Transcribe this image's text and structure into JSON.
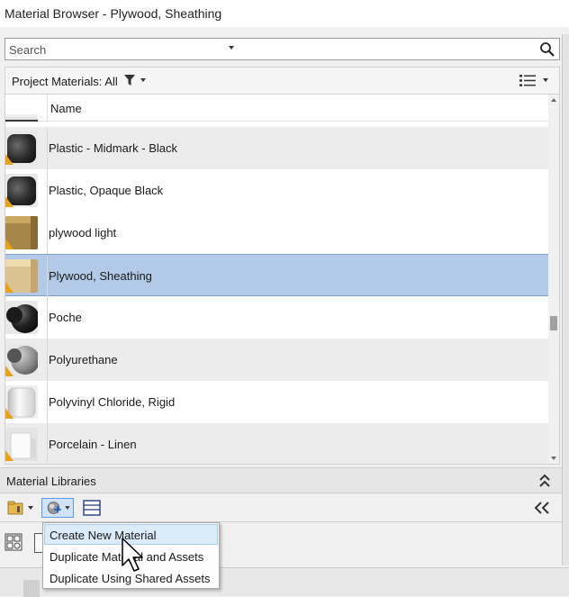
{
  "window": {
    "title": "Material Browser - Plywood, Sheathing"
  },
  "search": {
    "placeholder": "Search"
  },
  "filter": {
    "label": "Project Materials: All"
  },
  "list": {
    "column_header": "Name",
    "rows": [
      {
        "label": "Plastic - Midmark - Black",
        "thumb": "black-cylinder",
        "warning": true,
        "selected": false
      },
      {
        "label": "Plastic, Opaque Black",
        "thumb": "black-cylinder",
        "warning": true,
        "selected": false
      },
      {
        "label": "plywood light",
        "thumb": "wood-cube",
        "warning": true,
        "selected": false
      },
      {
        "label": "Plywood, Sheathing",
        "thumb": "light-wood-cube",
        "warning": true,
        "selected": true
      },
      {
        "label": "Poche",
        "thumb": "black-sphere",
        "warning": false,
        "selected": false
      },
      {
        "label": "Polyurethane",
        "thumb": "grey-sphere",
        "warning": true,
        "selected": false
      },
      {
        "label": "Polyvinyl Chloride, Rigid",
        "thumb": "white-cylinder",
        "warning": true,
        "selected": false
      },
      {
        "label": "Porcelain - Linen",
        "thumb": "white-shape",
        "warning": true,
        "selected": false
      }
    ]
  },
  "libraries": {
    "label": "Material Libraries"
  },
  "context_menu": {
    "items": [
      {
        "label": "Create New Material"
      },
      {
        "label": "Duplicate Material and Assets"
      },
      {
        "label": "Duplicate Using Shared Assets"
      }
    ]
  },
  "colors": {
    "selection": "#b3c9e8",
    "warning": "#e9a219",
    "hover": "#dcebf8"
  }
}
